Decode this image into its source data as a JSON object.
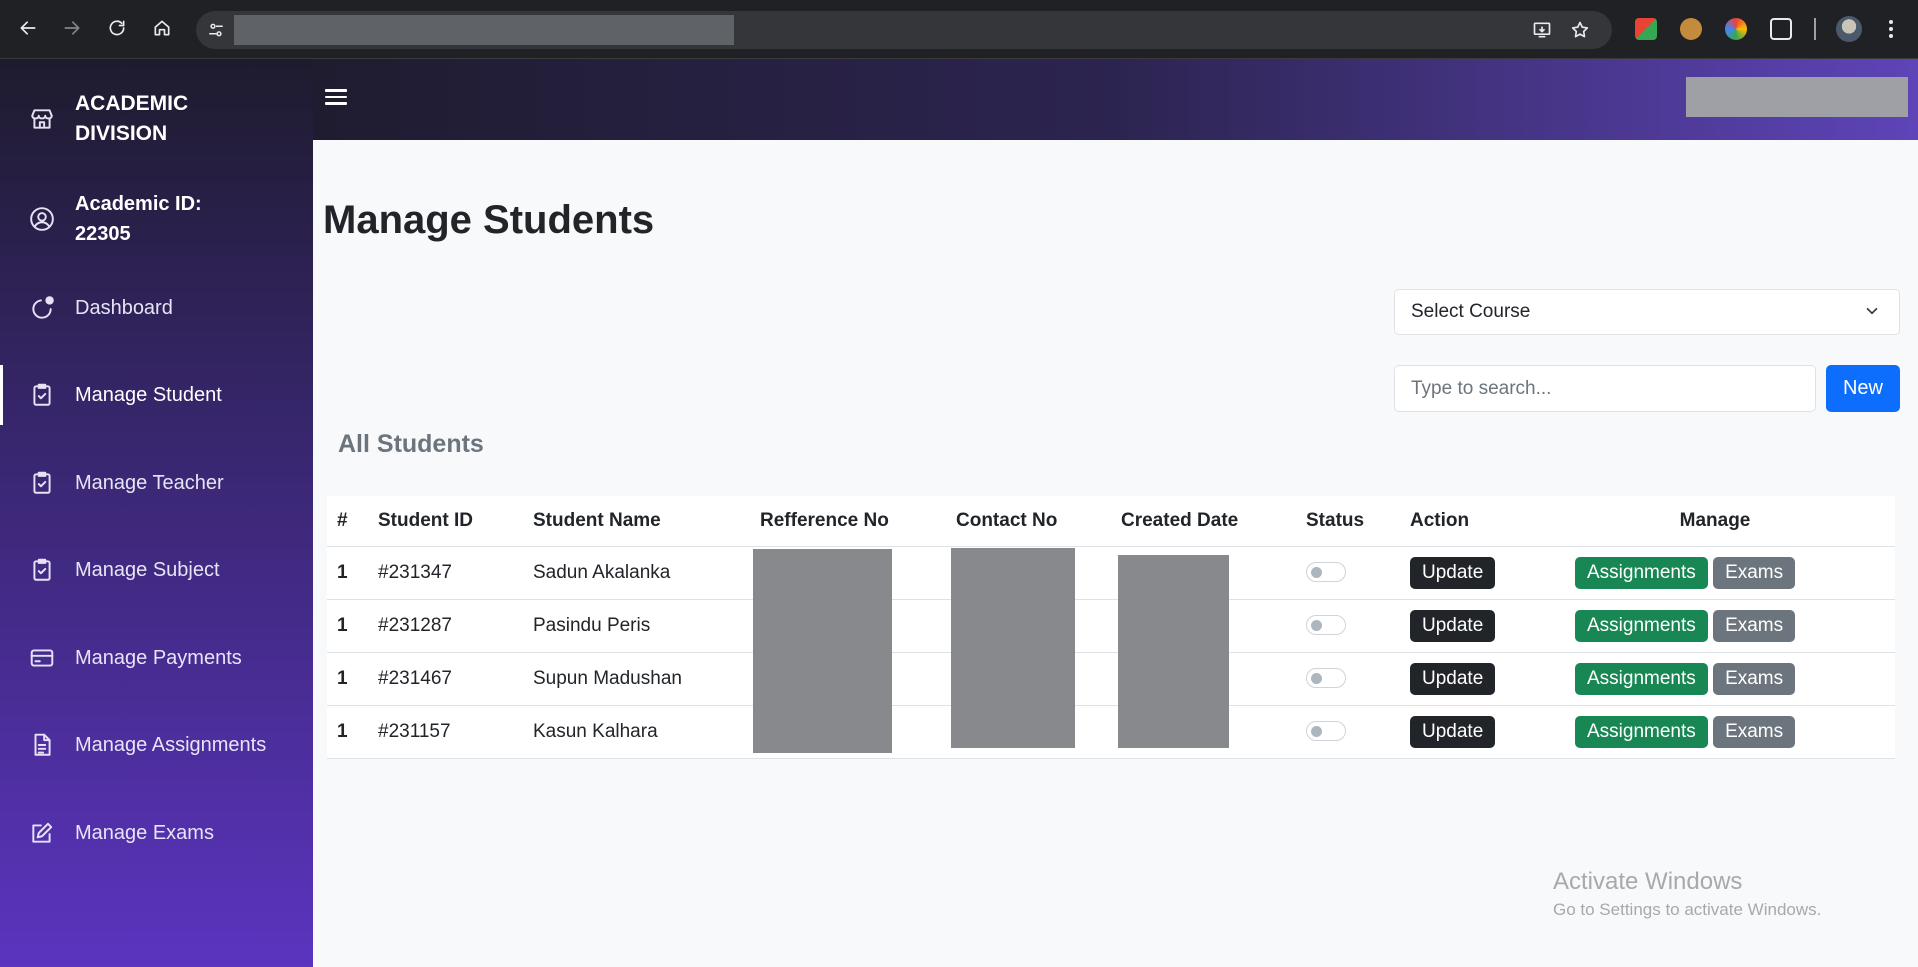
{
  "browser": {
    "nav_icons": [
      "back-arrow-icon",
      "forward-arrow-icon",
      "reload-icon",
      "home-icon"
    ],
    "site_info_icon": "tune-icon",
    "omnibox_icons": [
      "install-app-icon",
      "bookmark-star-icon"
    ],
    "extension_icons": [
      "extension-google-icon",
      "extension-cookie-icon",
      "extension-color-icon",
      "extensions-puzzle-icon"
    ],
    "menu_icon": "kebab-menu-icon"
  },
  "sidebar": {
    "brand": "ACADEMIC DIVISION",
    "brand_icon": "store-icon",
    "academic_id": "Academic ID: 22305",
    "academic_id_icon": "user-circle-icon",
    "items": [
      {
        "label": "Dashboard",
        "icon": "dashboard-icon"
      },
      {
        "label": "Manage Student",
        "icon": "clipboard-check-icon",
        "active": true
      },
      {
        "label": "Manage Teacher",
        "icon": "clipboard-check-icon"
      },
      {
        "label": "Manage Subject",
        "icon": "clipboard-check-icon"
      },
      {
        "label": "Manage Payments",
        "icon": "credit-card-icon"
      },
      {
        "label": "Manage Assignments",
        "icon": "file-text-icon"
      },
      {
        "label": "Manage Exams",
        "icon": "edit-square-icon"
      }
    ]
  },
  "main": {
    "title": "Manage Students",
    "select_course": "Select Course",
    "search_placeholder": "Type to search...",
    "new_button": "New",
    "section_title": "All Students"
  },
  "table": {
    "headers": [
      "#",
      "Student ID",
      "Student Name",
      "Refference No",
      "Contact No",
      "Created Date",
      "Status",
      "Action",
      "Manage"
    ],
    "rows": [
      {
        "num": "1",
        "id": "#231347",
        "name": "Sadun Akalanka",
        "status": false
      },
      {
        "num": "1",
        "id": "#231287",
        "name": "Pasindu Peris",
        "status": false
      },
      {
        "num": "1",
        "id": "#231467",
        "name": "Supun Madushan",
        "status": false
      },
      {
        "num": "1",
        "id": "#231157",
        "name": "Kasun Kalhara",
        "status": false
      }
    ],
    "update_label": "Update",
    "assignments_label": "Assignments",
    "exams_label": "Exams"
  },
  "watermark": {
    "line1": "Activate Windows",
    "line2": "Go to Settings to activate Windows."
  }
}
